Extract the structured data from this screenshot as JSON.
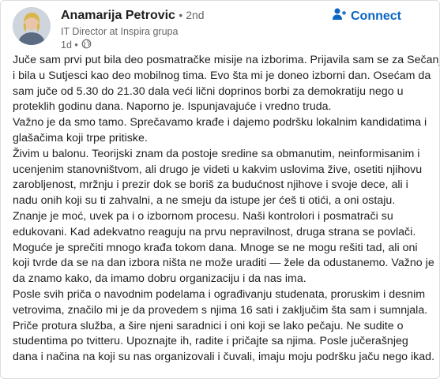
{
  "author": {
    "name": "Anamarija Petrovic",
    "degree": "• 2nd",
    "headline": "IT Director at Inspira grupa",
    "time": "1d •"
  },
  "actions": {
    "connect_label": "Connect"
  },
  "icons": {
    "connect": "person-add-icon",
    "visibility": "globe-icon"
  },
  "colors": {
    "accent": "#0a66c2",
    "text": "#1f1f1f",
    "muted": "#666666"
  },
  "post": {
    "lines": [
      "Juče sam prvi put bila deo posmatračke misije na izborima. Prijavila sam se za Sečanj",
      "i bila u Sutjesci kao deo mobilnog tima. Evo šta mi je doneo izborni dan. Osećam da",
      "sam juče od 5.30 do 21.30 dala veći lični doprinos borbi za demokratiju nego u",
      "proteklih godinu dana. Naporno je. Ispunjavajuće i vredno truda.",
      "Važno je da smo tamo. Sprečavamo krađe i dajemo podršku lokalnim kandidatima i",
      "glašačima koji trpe pritiske.",
      "Živim u balonu. Teorijski znam da postoje sredine sa obmanutim, neinformisanim i",
      "ucenjenim stanovništvom, ali drugo je videti u kakvim uslovima žive, osetiti njihovu",
      "zarobljenost, mržnju i prezir dok se boriš za budućnost njihove i svoje dece, ali i",
      "nadu onih koji su ti zahvalni, a ne smeju da istupe jer ćeš ti otići, a oni ostaju.",
      "Znanje je moć, uvek pa i o izbornom procesu. Naši kontrolori i posmatrači su",
      "edukovani. Kad adekvatno reaguju na prvu nepravilnost, druga strana se povlači.",
      "Moguće je sprečiti mnogo krađa tokom dana. Mnoge se ne mogu rešiti tad, ali oni",
      "koji tvrde da se na dan izbora ništa ne može uraditi — žele da odustanemo. Važno je",
      "da znamo kako, da imamo dobru organizaciju i da nas ima.",
      "Posle svih priča o navodnim podelama i ograđivanju studenata, proruskim i desnim",
      "vetrovima, značilo mi je da provedem s njima 16 sati i zaključim šta sam i sumnjala.",
      "Priče protura služba, a šire njeni saradnici i oni koji se lako pečaju. Ne sudite o",
      "studentima po tvitteru. Upoznajte ih, radite i pričajte sa njima. Posle jučerašnjeg",
      "dana i načina na koji su nas organizovali i čuvali, imaju moju podršku jaču nego ikad."
    ]
  }
}
